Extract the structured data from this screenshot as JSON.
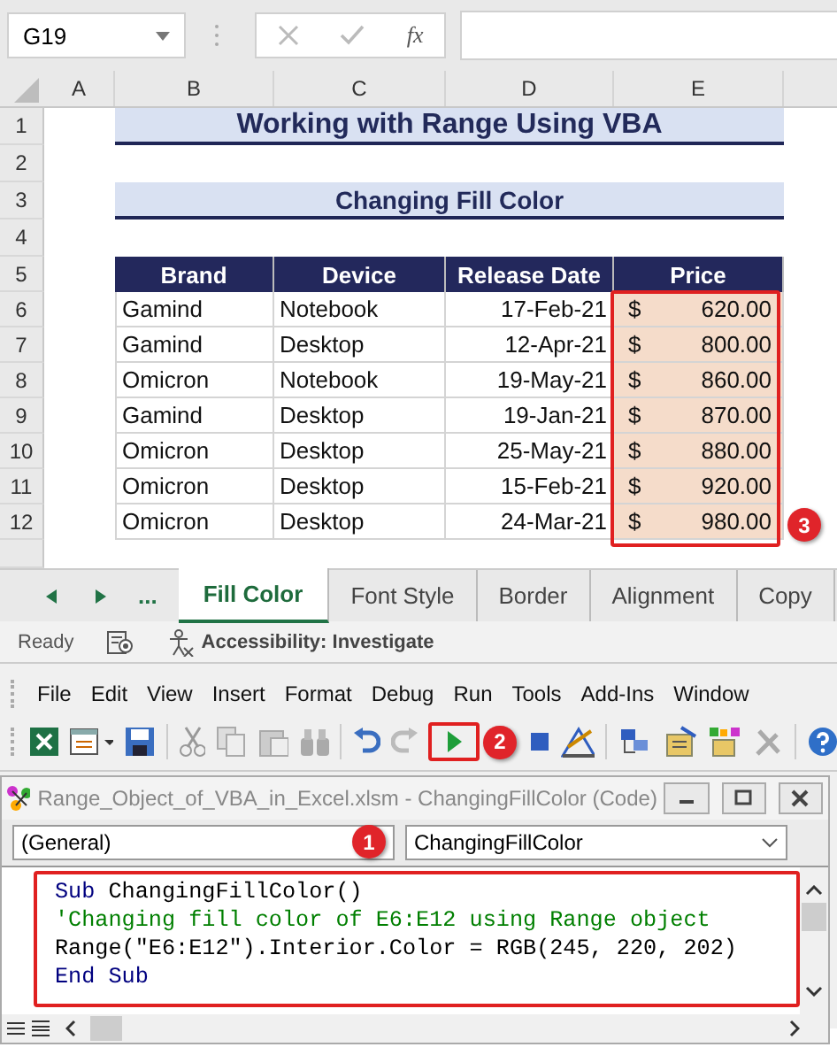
{
  "formula_bar": {
    "name_box": "G19",
    "fx": "fx"
  },
  "columns": [
    "A",
    "B",
    "C",
    "D",
    "E"
  ],
  "sheet": {
    "rows": [
      {
        "number": "1",
        "kind": "title",
        "text": "Working with Range Using VBA"
      },
      {
        "number": "2",
        "kind": "empty"
      },
      {
        "number": "3",
        "kind": "title",
        "text": "Changing Fill Color"
      },
      {
        "number": "4",
        "kind": "empty"
      },
      {
        "number": "5",
        "kind": "header",
        "cells": [
          "Brand",
          "Device",
          "Release Date",
          "Price"
        ]
      },
      {
        "number": "6",
        "kind": "data",
        "cells": [
          "Gamind",
          "Notebook",
          "17-Feb-21"
        ],
        "currency": "$",
        "price": "620.00"
      },
      {
        "number": "7",
        "kind": "data",
        "cells": [
          "Gamind",
          "Desktop",
          "12-Apr-21"
        ],
        "currency": "$",
        "price": "800.00"
      },
      {
        "number": "8",
        "kind": "data",
        "cells": [
          "Omicron",
          "Notebook",
          "19-May-21"
        ],
        "currency": "$",
        "price": "860.00"
      },
      {
        "number": "9",
        "kind": "data",
        "cells": [
          "Gamind",
          "Desktop",
          "19-Jan-21"
        ],
        "currency": "$",
        "price": "870.00"
      },
      {
        "number": "10",
        "kind": "data",
        "cells": [
          "Omicron",
          "Desktop",
          "25-May-21"
        ],
        "currency": "$",
        "price": "880.00"
      },
      {
        "number": "11",
        "kind": "data",
        "cells": [
          "Omicron",
          "Desktop",
          "15-Feb-21"
        ],
        "currency": "$",
        "price": "920.00"
      },
      {
        "number": "12",
        "kind": "data",
        "cells": [
          "Omicron",
          "Desktop",
          "24-Mar-21"
        ],
        "currency": "$",
        "price": "980.00"
      }
    ],
    "price_callout": "3"
  },
  "sheet_tabs": {
    "more": "...",
    "tabs": [
      {
        "label": "Fill Color",
        "selected": true
      },
      {
        "label": "Font Style",
        "selected": false
      },
      {
        "label": "Border",
        "selected": false
      },
      {
        "label": "Alignment",
        "selected": false
      },
      {
        "label": "Copy",
        "selected": false
      }
    ]
  },
  "status_bar": {
    "ready": "Ready",
    "accessibility": "Accessibility: Investigate"
  },
  "vbe": {
    "menu": [
      "File",
      "Edit",
      "View",
      "Insert",
      "Format",
      "Debug",
      "Run",
      "Tools",
      "Add-Ins",
      "Window"
    ],
    "run_callout": "2",
    "code_window": {
      "title": "Range_Object_of_VBA_in_Excel.xlsm - ChangingFillColor (Code)",
      "object_combo": "(General)",
      "object_callout": "1",
      "procedure_combo": "ChangingFillColor",
      "lines": [
        [
          {
            "text": "Sub",
            "kind": "keyword"
          },
          {
            "text": " ChangingFillColor()",
            "kind": "plain"
          }
        ],
        [
          {
            "text": "'Changing fill color of E6:E12 using Range object",
            "kind": "comment"
          }
        ],
        [
          {
            "text": "Range(\"E6:E12\").Interior.Color = RGB(245, 220, 202)",
            "kind": "plain"
          }
        ],
        [
          {
            "text": "End Sub",
            "kind": "keyword"
          }
        ]
      ]
    }
  }
}
